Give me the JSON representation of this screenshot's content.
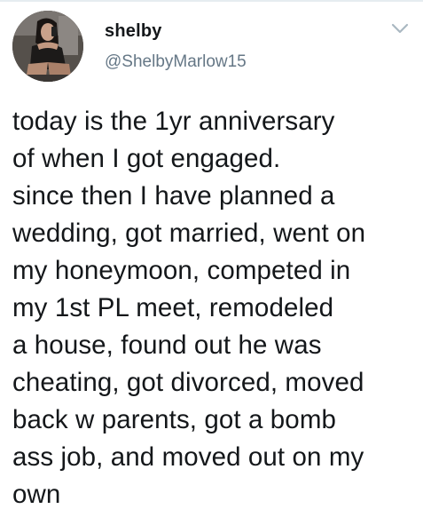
{
  "tweet": {
    "display_name": "shelby",
    "handle": "@ShelbyMarlow15",
    "text": "today is the 1yr anniversary\nof when I got engaged.\nsince then I have planned a\nwedding, got married, went on\nmy honeymoon, competed in\nmy 1st PL meet, remodeled\na house, found out he was\ncheating, got divorced, moved\nback w parents, got a bomb\nass job, and moved out on my\nown"
  },
  "icons": {
    "menu": "chevron-down-icon",
    "avatar": "profile-photo"
  },
  "colors": {
    "text": "#14171a",
    "secondary_text": "#657786",
    "chevron": "#aab8c2",
    "divider": "#e6ecf0"
  }
}
